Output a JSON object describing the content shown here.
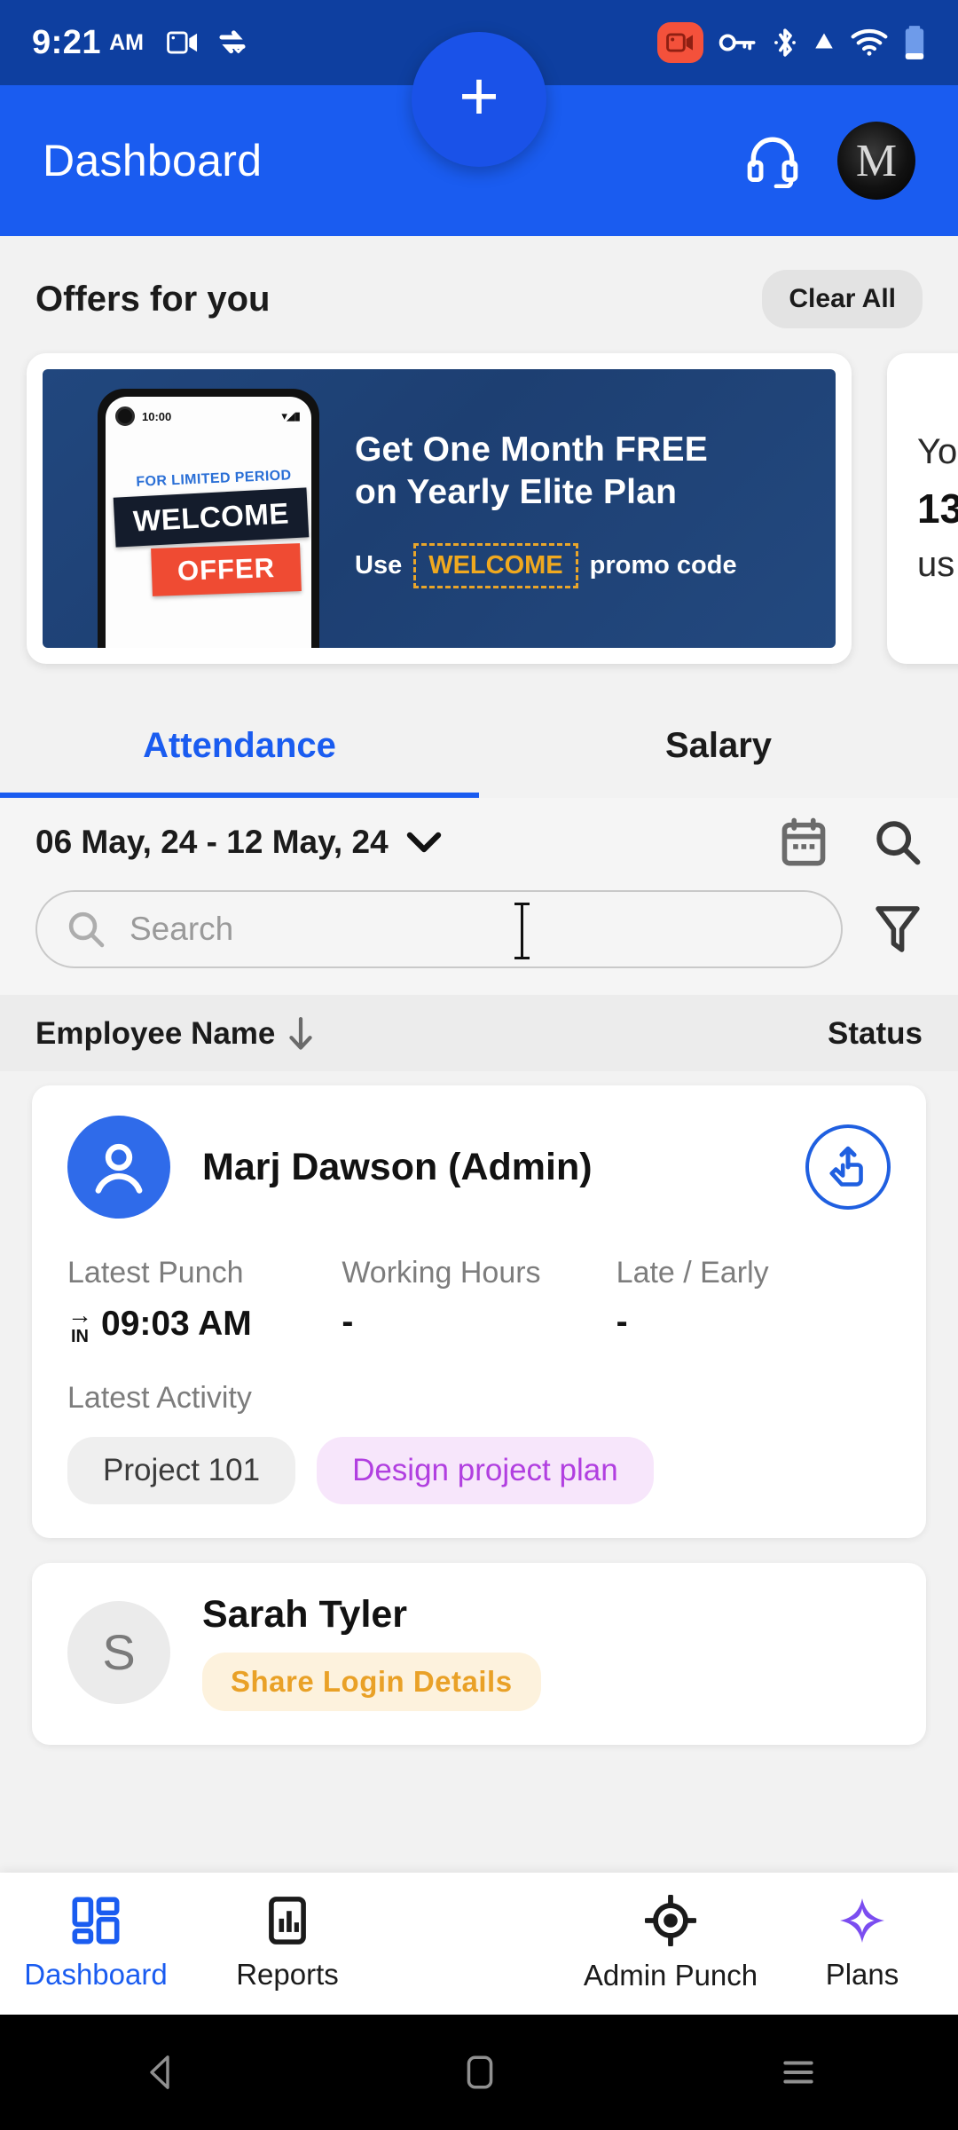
{
  "status_bar": {
    "time": "9:21",
    "ampm": "AM",
    "icons": [
      "screen-cast-icon",
      "sync-check-icon",
      "screen-record-icon",
      "vpn-key-icon",
      "bluetooth-icon",
      "signal-icon",
      "wifi-icon",
      "battery-icon"
    ]
  },
  "app_bar": {
    "title": "Dashboard",
    "support_icon": "headset-icon",
    "avatar_letter": "M"
  },
  "offers": {
    "section_title": "Offers for you",
    "clear_all_label": "Clear All",
    "banner": {
      "headline_line1": "Get One Month FREE",
      "headline_line2": "on Yearly Elite Plan",
      "promo_prefix": "Use",
      "promo_code": "WELCOME",
      "promo_suffix": "promo code",
      "phone_time": "10:00",
      "sticker_top": "FOR LIMITED PERIOD",
      "sticker_main": "WELCOME",
      "sticker_sub": "OFFER"
    },
    "second_card": {
      "line1": "Yo",
      "line2": "13",
      "line3": "us"
    }
  },
  "tabs": [
    {
      "label": "Attendance",
      "active": true
    },
    {
      "label": "Salary",
      "active": false
    }
  ],
  "filters": {
    "date_range": "06 May, 24 - 12 May, 24",
    "calendar_icon": "calendar-icon",
    "search_icon": "search-icon",
    "filter_icon": "funnel-filter-icon",
    "search_placeholder": "Search",
    "search_value": ""
  },
  "table": {
    "col_name": "Employee Name",
    "sort_arrow": "↓",
    "col_status": "Status"
  },
  "employees": [
    {
      "name": "Marj Dawson (Admin)",
      "avatar_type": "person-icon",
      "punch_action_icon": "tap-punch-icon",
      "stats": [
        {
          "label": "Latest Punch",
          "value": "09:03 AM",
          "direction": "IN"
        },
        {
          "label": "Working Hours",
          "value": "-"
        },
        {
          "label": "Late / Early",
          "value": "-"
        }
      ],
      "activity_label": "Latest Activity",
      "chips": [
        {
          "text": "Project 101",
          "style": "gray"
        },
        {
          "text": "Design project plan",
          "style": "purple"
        }
      ]
    },
    {
      "name": "Sarah Tyler",
      "avatar_type": "letter",
      "avatar_letter": "S",
      "badge": "Share Login Details"
    }
  ],
  "bottom_nav": [
    {
      "label": "Dashboard",
      "icon": "grid-dashboard-icon",
      "active": true
    },
    {
      "label": "Reports",
      "icon": "bar-chart-report-icon",
      "active": false
    },
    {
      "label": "Admin Punch",
      "icon": "target-punch-icon",
      "active": false
    },
    {
      "label": "Plans",
      "icon": "sparkle-diamond-icon",
      "active": false
    }
  ],
  "fab": {
    "label": "+",
    "icon": "plus-icon"
  },
  "android_nav": [
    "back-triangle-icon",
    "home-square-icon",
    "recents-menu-icon"
  ],
  "colors": {
    "status_bar": "#0e3fa0",
    "app_bar": "#1a5cf0",
    "accent": "#1a5cf0",
    "banner_bg": "#21477e",
    "promo_yellow": "#f0a91f",
    "chip_purple": "#b13fe0",
    "badge_orange": "#e9a127",
    "plans_purple": "#7b4df0"
  }
}
